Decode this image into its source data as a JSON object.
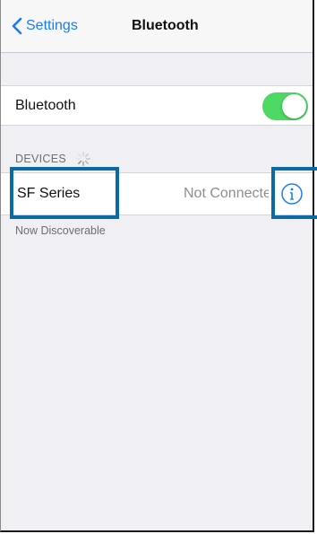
{
  "nav": {
    "back_label": "Settings",
    "title": "Bluetooth"
  },
  "bluetooth_row": {
    "label": "Bluetooth",
    "toggle_on": true
  },
  "devices": {
    "header": "DEVICES",
    "items": [
      {
        "name": "SF Series",
        "status": "Not Connected"
      }
    ]
  },
  "footer": {
    "text": "Now Discoverable"
  },
  "colors": {
    "accent": "#1a7cf5",
    "toggle_on": "#4cd964",
    "highlight_border": "#0a6aa8"
  },
  "icons": {
    "back": "chevron-left-icon",
    "spinner": "activity-spinner-icon",
    "info": "info-circle-icon"
  }
}
